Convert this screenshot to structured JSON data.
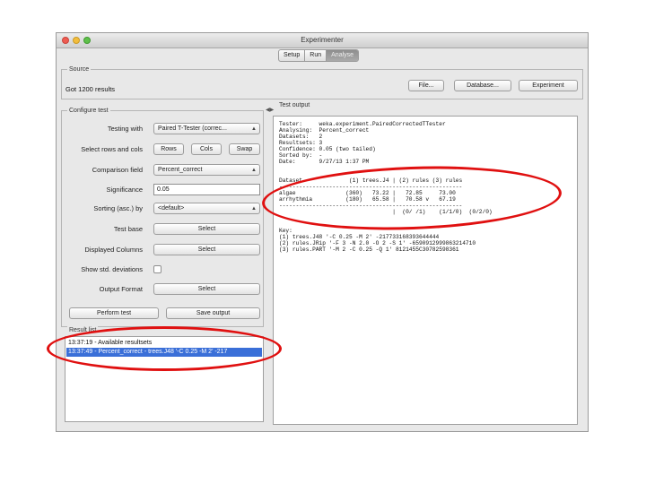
{
  "window": {
    "title": "Experimenter"
  },
  "tabs": [
    {
      "label": "Setup"
    },
    {
      "label": "Run"
    },
    {
      "label": "Analyse"
    }
  ],
  "source": {
    "legend": "Source",
    "status": "Got 1200 results",
    "file_button": "File...",
    "database_button": "Database...",
    "experiment_button": "Experiment"
  },
  "configure": {
    "legend": "Configure test",
    "testing_with_label": "Testing with",
    "testing_with_value": "Paired T-Tester (correc...",
    "select_rows_label": "Select rows and cols",
    "rows_button": "Rows",
    "cols_button": "Cols",
    "swap_button": "Swap",
    "comparison_label": "Comparison field",
    "comparison_value": "Percent_correct",
    "significance_label": "Significance",
    "significance_value": "0.05",
    "sorting_label": "Sorting (asc.) by",
    "sorting_value": "<default>",
    "test_base_label": "Test base",
    "test_base_button": "Select",
    "displayed_columns_label": "Displayed Columns",
    "displayed_columns_button": "Select",
    "show_std_label": "Show std. deviations",
    "output_format_label": "Output Format",
    "output_format_button": "Select",
    "perform_test_button": "Perform test",
    "save_output_button": "Save output"
  },
  "result_list": {
    "legend": "Result list",
    "items": [
      "13:37:19 - Available resultsets",
      "13:37:49 - Percent_correct - trees.J48 '-C 0.25 -M 2' -217"
    ]
  },
  "test_output": {
    "legend": "Test output",
    "lines": [
      "Tester:     weka.experiment.PairedCorrectedTTester",
      "Analysing:  Percent_correct",
      "Datasets:   2",
      "Resultsets: 3",
      "Confidence: 0.05 (two tailed)",
      "Sorted by:  -",
      "Date:       9/27/13 1:37 PM",
      "",
      "",
      "Dataset              (1) trees.J4 | (2) rules (3) rules",
      "-------------------------------------------------------",
      "algae               (360)   73.22 |   72.85     73.00",
      "arrhythmia          (180)   65.58 |   70.58 v   67.19",
      "-------------------------------------------------------",
      "                                  |  (0/ /1)    (1/1/0)  (0/2/0)",
      "",
      "",
      "Key:",
      "(1) trees.J48 '-C 0.25 -M 2' -217733168393644444",
      "(2) rules.JRip '-F 3 -N 2.0 -O 2 -S 1' -6590912999863214710",
      "(3) rules.PART '-M 2 -C 0.25 -Q 1' 8121455C30782598361"
    ]
  },
  "colors": {
    "accent": "#3a6fd8",
    "annotation": "#e01010",
    "close_light": "#ee5c52",
    "minimize_light": "#f3bd3c",
    "zoom_light": "#5fc04a"
  }
}
